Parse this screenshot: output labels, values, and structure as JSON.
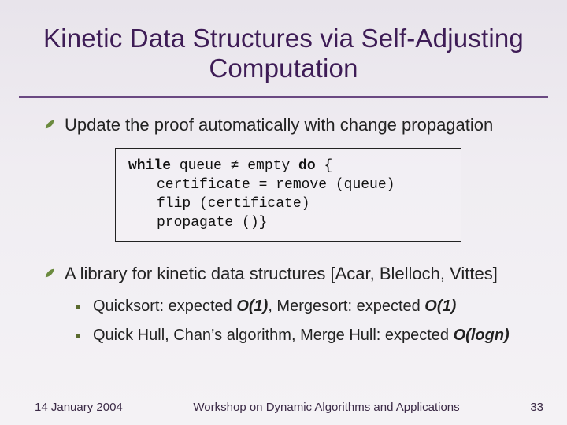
{
  "title": "Kinetic Data Structures via Self-Adjusting Computation",
  "bullets": {
    "b1": "Update the proof automatically with change propagation",
    "b2": "A library for kinetic data structures [Acar, Blelloch, Vittes]"
  },
  "sub": {
    "s1_pre": "Quicksort: expected ",
    "s1_o1": "O(1)",
    "s1_mid": ", Mergesort: expected ",
    "s1_o2": "O(1)",
    "s2_pre": "Quick Hull, Chan’s algorithm, Merge Hull: expected ",
    "s2_o": "O(logn)"
  },
  "code": {
    "l1a": "while",
    "l1b": " queue ≠ empty ",
    "l1c": "do",
    "l1d": " {",
    "l2": "certificate = remove (queue)",
    "l3": "flip (certificate)",
    "l4a": "propagate",
    "l4b": " ()}"
  },
  "footer": {
    "date": "14 January 2004",
    "venue": "Workshop on Dynamic Algorithms and Applications",
    "page": "33"
  }
}
